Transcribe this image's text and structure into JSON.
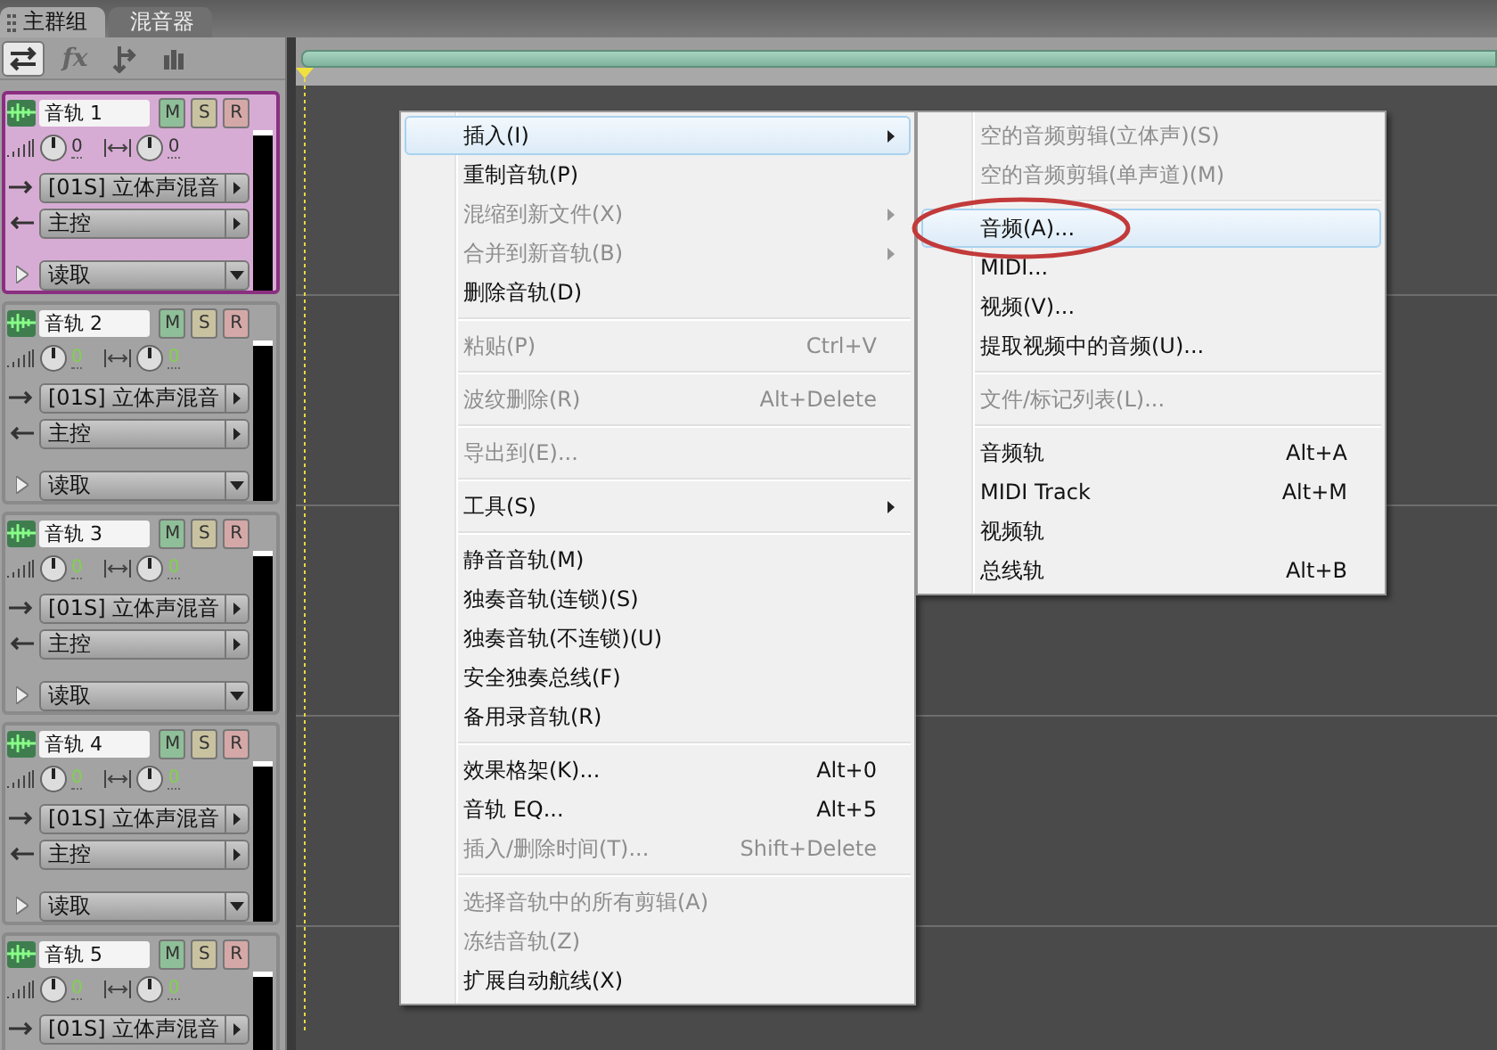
{
  "tabs": [
    {
      "label": "主群组",
      "selected": true
    },
    {
      "label": "混音器",
      "selected": false
    }
  ],
  "toolbar": [
    {
      "kind": "swap",
      "selected": true
    },
    {
      "kind": "fx",
      "label": "fx",
      "selected": false
    },
    {
      "kind": "send",
      "selected": false
    },
    {
      "kind": "bars",
      "selected": false
    }
  ],
  "tracks": [
    {
      "name": "音轨 1",
      "selected": true,
      "mute": "M",
      "solo": "S",
      "record": "R",
      "volume": "0",
      "pan": "0",
      "input": "[01S] 立体声混音",
      "output": "主控",
      "automation": "读取"
    },
    {
      "name": "音轨 2",
      "selected": false,
      "mute": "M",
      "solo": "S",
      "record": "R",
      "volume": "0",
      "pan": "0",
      "input": "[01S] 立体声混音",
      "output": "主控",
      "automation": "读取"
    },
    {
      "name": "音轨 3",
      "selected": false,
      "mute": "M",
      "solo": "S",
      "record": "R",
      "volume": "0",
      "pan": "0",
      "input": "[01S] 立体声混音",
      "output": "主控",
      "automation": "读取"
    },
    {
      "name": "音轨 4",
      "selected": false,
      "mute": "M",
      "solo": "S",
      "record": "R",
      "volume": "0",
      "pan": "0",
      "input": "[01S] 立体声混音",
      "output": "主控",
      "automation": "读取"
    },
    {
      "name": "音轨 5",
      "selected": false,
      "mute": "M",
      "solo": "S",
      "record": "R",
      "volume": "0",
      "pan": "0",
      "input": "[01S] 立体声混音"
    }
  ],
  "context_menu": [
    {
      "kind": "item",
      "label": "插入(I)",
      "submenu": true,
      "disabled": false,
      "selected": true
    },
    {
      "kind": "item",
      "label": "重制音轨(P)",
      "disabled": false,
      "selected": false
    },
    {
      "kind": "item",
      "label": "混缩到新文件(X)",
      "submenu": true,
      "disabled": true,
      "selected": false
    },
    {
      "kind": "item",
      "label": "合并到新音轨(B)",
      "submenu": true,
      "disabled": true,
      "selected": false
    },
    {
      "kind": "item",
      "label": "删除音轨(D)",
      "disabled": false,
      "selected": false
    },
    {
      "kind": "separator"
    },
    {
      "kind": "item",
      "label": "粘贴(P)",
      "shortcut": "Ctrl+V",
      "disabled": true,
      "selected": false
    },
    {
      "kind": "separator"
    },
    {
      "kind": "item",
      "label": "波纹删除(R)",
      "shortcut": "Alt+Delete",
      "disabled": true,
      "selected": false
    },
    {
      "kind": "separator"
    },
    {
      "kind": "item",
      "label": "导出到(E)...",
      "disabled": true,
      "selected": false
    },
    {
      "kind": "separator"
    },
    {
      "kind": "item",
      "label": "工具(S)",
      "submenu": true,
      "disabled": false,
      "selected": false
    },
    {
      "kind": "separator"
    },
    {
      "kind": "item",
      "label": "静音音轨(M)",
      "disabled": false,
      "selected": false
    },
    {
      "kind": "item",
      "label": "独奏音轨(连锁)(S)",
      "disabled": false,
      "selected": false
    },
    {
      "kind": "item",
      "label": "独奏音轨(不连锁)(U)",
      "disabled": false,
      "selected": false
    },
    {
      "kind": "item",
      "label": "安全独奏总线(F)",
      "disabled": false,
      "selected": false
    },
    {
      "kind": "item",
      "label": "备用录音轨(R)",
      "disabled": false,
      "selected": false
    },
    {
      "kind": "separator"
    },
    {
      "kind": "item",
      "label": "效果格架(K)...",
      "shortcut": "Alt+0",
      "disabled": false,
      "selected": false
    },
    {
      "kind": "item",
      "label": "音轨 EQ...",
      "shortcut": "Alt+5",
      "disabled": false,
      "selected": false
    },
    {
      "kind": "item",
      "label": "插入/删除时间(T)...",
      "shortcut": "Shift+Delete",
      "disabled": true,
      "selected": false
    },
    {
      "kind": "separator"
    },
    {
      "kind": "item",
      "label": "选择音轨中的所有剪辑(A)",
      "disabled": true,
      "selected": false
    },
    {
      "kind": "item",
      "label": "冻结音轨(Z)",
      "disabled": true,
      "selected": false
    },
    {
      "kind": "item",
      "label": "扩展自动航线(X)",
      "disabled": false,
      "selected": false
    }
  ],
  "submenu": [
    {
      "kind": "item",
      "label": "空的音频剪辑(立体声)(S)",
      "disabled": true,
      "selected": false
    },
    {
      "kind": "item",
      "label": "空的音频剪辑(单声道)(M)",
      "disabled": true,
      "selected": false
    },
    {
      "kind": "separator"
    },
    {
      "kind": "item",
      "label": "音频(A)...",
      "disabled": false,
      "selected": true,
      "circled": true
    },
    {
      "kind": "item",
      "label": "MIDI...",
      "disabled": false,
      "selected": false
    },
    {
      "kind": "item",
      "label": "视频(V)...",
      "disabled": false,
      "selected": false
    },
    {
      "kind": "item",
      "label": "提取视频中的音频(U)...",
      "disabled": false,
      "selected": false
    },
    {
      "kind": "separator"
    },
    {
      "kind": "item",
      "label": "文件/标记列表(L)...",
      "disabled": true,
      "selected": false
    },
    {
      "kind": "separator"
    },
    {
      "kind": "item",
      "label": "音频轨",
      "shortcut": "Alt+A",
      "disabled": false,
      "selected": false
    },
    {
      "kind": "item",
      "label": "MIDI Track",
      "shortcut": "Alt+M",
      "disabled": false,
      "selected": false
    },
    {
      "kind": "item",
      "label": "视频轨",
      "disabled": false,
      "selected": false
    },
    {
      "kind": "item",
      "label": "总线轨",
      "shortcut": "Alt+B",
      "disabled": false,
      "selected": false
    }
  ]
}
